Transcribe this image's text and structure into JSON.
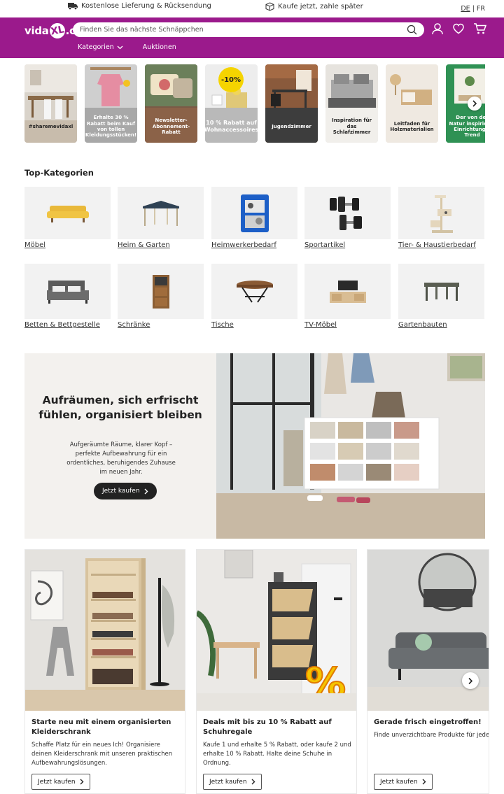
{
  "promo": {
    "shipping": "Kostenlose Lieferung & Rücksendung",
    "pay_later": "Kaufe jetzt, zahle später",
    "lang_de": "DE",
    "lang_sep": "|",
    "lang_fr": "FR"
  },
  "header": {
    "logo_part1": "vida",
    "logo_part2": "XL",
    "logo_part3": ".ch",
    "search_placeholder": "Finden Sie das nächste Schnäppchen",
    "nav": [
      "Kategorien",
      "Auktionen"
    ],
    "icons": [
      "user-icon",
      "heart-icon",
      "cart-icon"
    ]
  },
  "stories": [
    {
      "caption": "#sharemevidaxl"
    },
    {
      "caption": "Erhalte 30 % Rabatt beim Kauf von tollen Kleidungsstücken!"
    },
    {
      "caption": "Newsletter-Abonnement-Rabatt"
    },
    {
      "caption": "10 % Rabatt auf Wohnaccessoires",
      "badge": "-10%"
    },
    {
      "caption": "Jugendzimmer"
    },
    {
      "caption": "Inspiration für das Schlafzimmer"
    },
    {
      "caption": "Leitfaden für Holzmaterialien"
    },
    {
      "caption": "Der von der Natur inspirierte Einrichtungs-Trend"
    }
  ],
  "top_categories": {
    "title": "Top-Kategorien",
    "items": [
      {
        "label": "Möbel",
        "icon": "sofa-icon"
      },
      {
        "label": "Heim & Garten",
        "icon": "gazebo-icon"
      },
      {
        "label": "Heimwerkerbedarf",
        "icon": "toolcase-icon"
      },
      {
        "label": "Sportartikel",
        "icon": "dumbbell-icon"
      },
      {
        "label": "Tier- & Haustierbedarf",
        "icon": "cat-tree-icon"
      },
      {
        "label": "Betten & Bettgestelle",
        "icon": "bed-icon"
      },
      {
        "label": "Schränke",
        "icon": "cabinet-icon"
      },
      {
        "label": "Tische",
        "icon": "table-icon"
      },
      {
        "label": "TV-Möbel",
        "icon": "tv-stand-icon"
      },
      {
        "label": "Gartenbauten",
        "icon": "pergola-icon"
      }
    ]
  },
  "banner": {
    "title": "Aufräumen, sich erfrischt fühlen, organisiert bleiben",
    "body": "Aufgeräumte Räume, klarer Kopf – perfekte Aufbewahrung für ein ordentliches, beruhigendes Zuhause im neuen Jahr.",
    "cta": "Jetzt kaufen"
  },
  "cards": [
    {
      "title": "Starte neu mit einem organisierten Kleiderschrank",
      "body": "Schaffe Platz für ein neues Ich! Organisiere deinen Kleiderschrank mit unseren praktischen Aufbewahrungslösungen.",
      "cta": "Jetzt kaufen"
    },
    {
      "title": "Deals mit bis zu 10 % Rabatt auf Schuhregale",
      "body": "Kaufe 1 und erhalte 5 % Rabatt, oder kaufe 2 und erhalte 10 % Rabatt. Halte deine Schuhe in Ordnung.",
      "cta": "Jetzt kaufen"
    },
    {
      "title": "Gerade frisch eingetroffen!",
      "body": "Finde unverzichtbare Produkte für jede",
      "cta": "Jetzt kaufen"
    }
  ],
  "colors": {
    "brand": "#9b1a8c",
    "dark_button": "#222222",
    "tile_bg": "#f2f2f2"
  }
}
